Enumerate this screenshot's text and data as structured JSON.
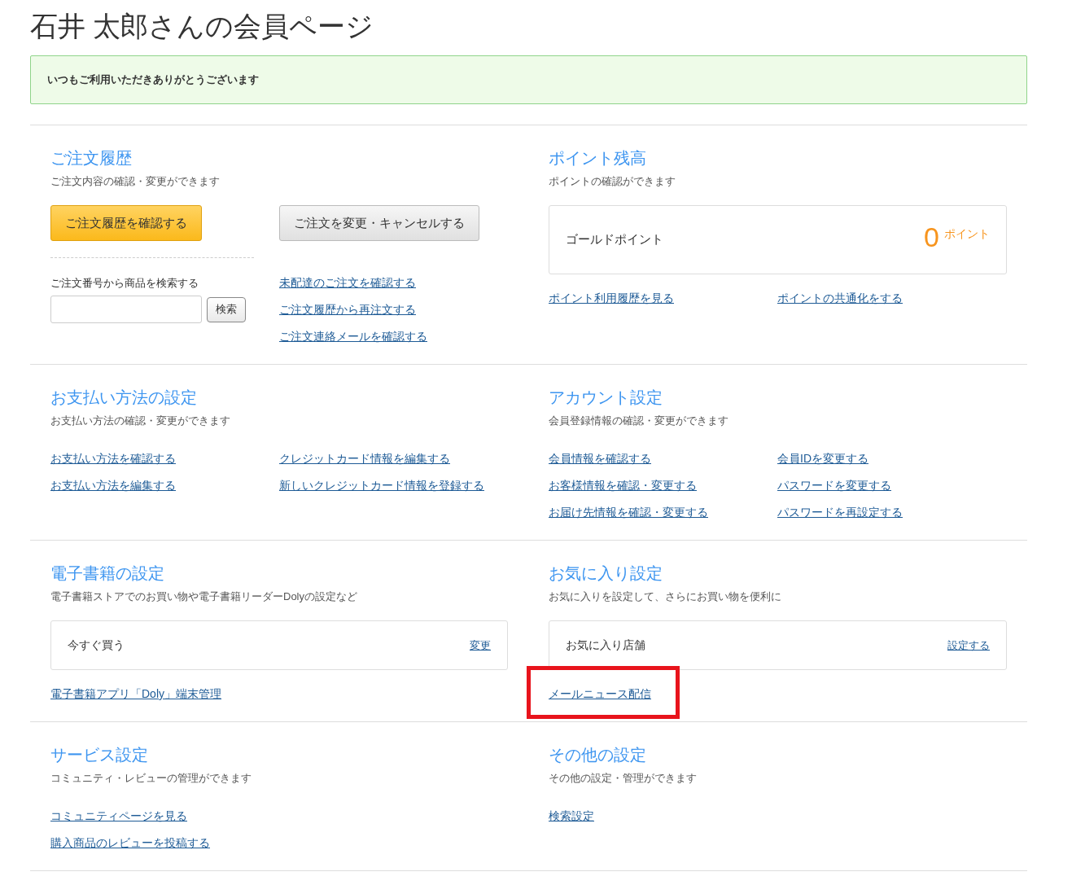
{
  "page_title": "石井 太郎さんの会員ページ",
  "notice": "いつもご利用いただきありがとうございます",
  "rows": [
    {
      "sections": [
        {
          "title": "ご注文履歴",
          "description": "ご注文内容の確認・変更ができます",
          "blocks": [
            {
              "kind": "order",
              "buttons": [
                {
                  "text": "ご注文履歴を確認する",
                  "kind": "primary"
                },
                {
                  "text": "ご注文を変更・キャンセルする",
                  "kind": "secondary"
                }
              ],
              "search": {
                "label": "ご注文番号から商品を検索する",
                "button": "検索"
              },
              "links": [
                {
                  "text": "未配達のご注文を確認する",
                  "highlighted": false
                },
                {
                  "text": "ご注文履歴から再注文する",
                  "highlighted": false
                },
                {
                  "text": "ご注文連絡メールを確認する",
                  "highlighted": false
                }
              ]
            }
          ]
        },
        {
          "title": "ポイント残高",
          "description": "ポイントの確認ができます",
          "blocks": [
            {
              "kind": "points",
              "label": "ゴールドポイント",
              "value": "0",
              "unit": "ポイント"
            },
            {
              "kind": "links",
              "columns": [
                [
                  {
                    "text": "ポイント利用履歴を見る",
                    "highlighted": false
                  }
                ],
                [
                  {
                    "text": "ポイントの共通化をする",
                    "highlighted": false
                  }
                ]
              ]
            }
          ]
        }
      ]
    },
    {
      "sections": [
        {
          "title": "お支払い方法の設定",
          "description": "お支払い方法の確認・変更ができます",
          "blocks": [
            {
              "kind": "links",
              "columns": [
                [
                  {
                    "text": "お支払い方法を確認する",
                    "highlighted": false
                  },
                  {
                    "text": "お支払い方法を編集する",
                    "highlighted": false
                  }
                ],
                [
                  {
                    "text": "クレジットカード情報を編集する",
                    "highlighted": false
                  },
                  {
                    "text": "新しいクレジットカード情報を登録する",
                    "highlighted": false
                  }
                ]
              ]
            }
          ]
        },
        {
          "title": "アカウント設定",
          "description": "会員登録情報の確認・変更ができます",
          "blocks": [
            {
              "kind": "links",
              "columns": [
                [
                  {
                    "text": "会員情報を確認する",
                    "highlighted": false
                  },
                  {
                    "text": "お客様情報を確認・変更する",
                    "highlighted": false
                  },
                  {
                    "text": "お届け先情報を確認・変更する",
                    "highlighted": false
                  }
                ],
                [
                  {
                    "text": "会員IDを変更する",
                    "highlighted": false
                  },
                  {
                    "text": "パスワードを変更する",
                    "highlighted": false
                  },
                  {
                    "text": "パスワードを再設定する",
                    "highlighted": false
                  }
                ]
              ]
            }
          ]
        }
      ]
    },
    {
      "sections": [
        {
          "title": "電子書籍の設定",
          "description": "電子書籍ストアでのお買い物や電子書籍リーダーDolyの設定など",
          "blocks": [
            {
              "kind": "setting",
              "label": "今すぐ買う",
              "action": "変更"
            },
            {
              "kind": "links",
              "columns": [
                [
                  {
                    "text": "電子書籍アプリ「Doly」端末管理",
                    "highlighted": false
                  }
                ]
              ]
            }
          ]
        },
        {
          "title": "お気に入り設定",
          "description": "お気に入りを設定して、さらにお買い物を便利に",
          "blocks": [
            {
              "kind": "setting",
              "label": "お気に入り店舗",
              "action": "設定する"
            },
            {
              "kind": "links",
              "columns": [
                [
                  {
                    "text": "メールニュース配信",
                    "highlighted": true
                  }
                ]
              ]
            }
          ]
        }
      ]
    },
    {
      "sections": [
        {
          "title": "サービス設定",
          "description": "コミュニティ・レビューの管理ができます",
          "blocks": [
            {
              "kind": "links",
              "columns": [
                [
                  {
                    "text": "コミュニティページを見る",
                    "highlighted": false
                  },
                  {
                    "text": "購入商品のレビューを投稿する",
                    "highlighted": false
                  }
                ]
              ]
            }
          ]
        },
        {
          "title": "その他の設定",
          "description": "その他の設定・管理ができます",
          "blocks": [
            {
              "kind": "links",
              "columns": [
                [
                  {
                    "text": "検索設定",
                    "highlighted": false
                  }
                ]
              ]
            }
          ]
        }
      ]
    }
  ]
}
